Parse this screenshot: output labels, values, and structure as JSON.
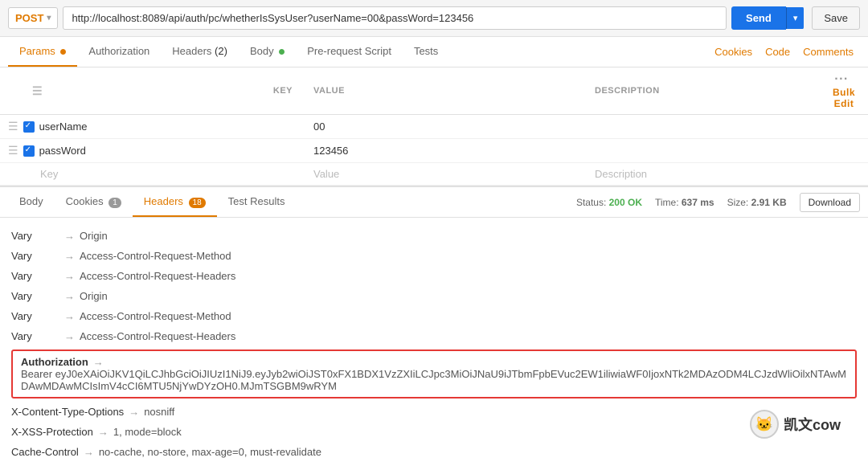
{
  "topbar": {
    "method": "POST",
    "url": "http://localhost:8089/api/auth/pc/whetherIsSysUser?userName=00&passWord=123456",
    "send_label": "Send",
    "save_label": "Save"
  },
  "request_tabs": [
    {
      "id": "params",
      "label": "Params",
      "dot": "orange",
      "active": true
    },
    {
      "id": "authorization",
      "label": "Authorization",
      "dot": null,
      "active": false
    },
    {
      "id": "headers",
      "label": "Headers (2)",
      "dot": null,
      "active": false
    },
    {
      "id": "body",
      "label": "Body",
      "dot": "green",
      "active": false
    },
    {
      "id": "pre-request",
      "label": "Pre-request Script",
      "dot": null,
      "active": false
    },
    {
      "id": "tests",
      "label": "Tests",
      "dot": null,
      "active": false
    }
  ],
  "right_tabs": [
    "Cookies",
    "Code",
    "Comments"
  ],
  "params_table": {
    "columns": [
      "KEY",
      "VALUE",
      "DESCRIPTION"
    ],
    "rows": [
      {
        "checked": true,
        "key": "userName",
        "value": "00",
        "description": ""
      },
      {
        "checked": true,
        "key": "passWord",
        "value": "123456",
        "description": ""
      }
    ],
    "placeholder_row": {
      "key": "Key",
      "value": "Value",
      "description": "Description"
    }
  },
  "response": {
    "status": "200 OK",
    "time": "637 ms",
    "size": "2.91 KB",
    "download_label": "Download",
    "tabs": [
      {
        "id": "body",
        "label": "Body",
        "badge": null,
        "active": false
      },
      {
        "id": "cookies",
        "label": "Cookies",
        "badge": "1",
        "active": false
      },
      {
        "id": "headers",
        "label": "Headers",
        "badge": "18",
        "active": true
      },
      {
        "id": "test-results",
        "label": "Test Results",
        "badge": null,
        "active": false
      }
    ],
    "headers": [
      {
        "key": "Vary",
        "value": "Origin"
      },
      {
        "key": "Vary",
        "value": "Access-Control-Request-Method"
      },
      {
        "key": "Vary",
        "value": "Access-Control-Request-Headers"
      },
      {
        "key": "Vary",
        "value": "Origin"
      },
      {
        "key": "Vary",
        "value": "Access-Control-Request-Method"
      },
      {
        "key": "Vary",
        "value": "Access-Control-Request-Headers"
      }
    ],
    "auth_header": {
      "key": "Authorization",
      "value": "Bearer eyJ0eXAiOiJKV1QiLCJhbGciOiJIUzI1NiJ9.eyJyb2wiOiJST0xFX1BDX1VzZXIiLCJpc3MiOiJNaU9iJTbmFpbEVuc2EW1iliwiaWF0IjoxNTk2MDAzODM4LCJzdWliOilxNTAwMDAwMDAwMCIsImV4cCI6MTU5NjYwDYzOH0.MJmTSGBM9wRYM"
    },
    "extra_headers": [
      {
        "key": "X-Content-Type-Options",
        "value": "nosniff"
      },
      {
        "key": "X-XSS-Protection",
        "value": "1, mode=block"
      },
      {
        "key": "Cache-Control",
        "value": "no-cache, no-store, max-age=0, must-revalidate"
      }
    ]
  },
  "watermark": {
    "text": "凯文cow"
  }
}
